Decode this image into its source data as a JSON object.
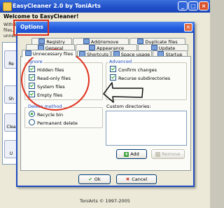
{
  "app": {
    "title": "EasyCleaner 2.0 by ToniArts",
    "welcome": "Welcome to EasyCleaner!",
    "intro_text": "With E... files, unnec...",
    "side_buttons": [
      {
        "label": "Re",
        "icon": "registry-icon"
      },
      {
        "label": "Sh",
        "icon": "shortcuts-icon"
      },
      {
        "label": "Clea",
        "icon": "cleaner-icon"
      },
      {
        "label": "U",
        "icon": "unused-icon"
      }
    ],
    "footer": "ToniArts © 1997-2005",
    "window_buttons": {
      "minimize": "_",
      "maximize": "□",
      "close": "×"
    }
  },
  "dialog": {
    "title": "Options",
    "close_glyph": "×",
    "tab_rows": [
      [
        {
          "label": "Registry",
          "icon": "registry-icon"
        },
        {
          "label": "Add/remove",
          "icon": "add-remove-icon"
        },
        {
          "label": "Duplicate files",
          "icon": "duplicate-files-icon"
        }
      ],
      [
        {
          "label": "General",
          "icon": "general-icon"
        },
        {
          "label": "Appearance",
          "icon": "appearance-icon"
        },
        {
          "label": "Update",
          "icon": "update-icon"
        }
      ],
      [
        {
          "label": "Unnecessary files",
          "icon": "unnecessary-files-icon",
          "active": true
        },
        {
          "label": "Shortcuts",
          "icon": "shortcuts-icon"
        },
        {
          "label": "Space usage",
          "icon": "space-usage-icon"
        },
        {
          "label": "Startup",
          "icon": "startup-icon"
        }
      ]
    ],
    "ignore": {
      "label": "Ignore",
      "items": [
        {
          "label": "Hidden files",
          "checked": true
        },
        {
          "label": "Read-only files",
          "checked": true
        },
        {
          "label": "System files",
          "checked": true
        },
        {
          "label": "Empty files",
          "checked": true
        }
      ]
    },
    "advanced": {
      "label": "Advanced",
      "items": [
        {
          "label": "Confirm changes",
          "checked": true
        },
        {
          "label": "Recurse subdirectories",
          "checked": true
        }
      ]
    },
    "delete_method": {
      "label": "Delete method",
      "options": [
        {
          "label": "Recycle bin",
          "selected": true
        },
        {
          "label": "Permanent delete",
          "selected": false
        }
      ]
    },
    "custom_dirs": {
      "label": "Custom directories:",
      "items": []
    },
    "buttons": {
      "add": "Add",
      "remove": "Remove",
      "ok": "Ok",
      "cancel": "Cancel"
    }
  },
  "annotation_color": "#e0311e"
}
